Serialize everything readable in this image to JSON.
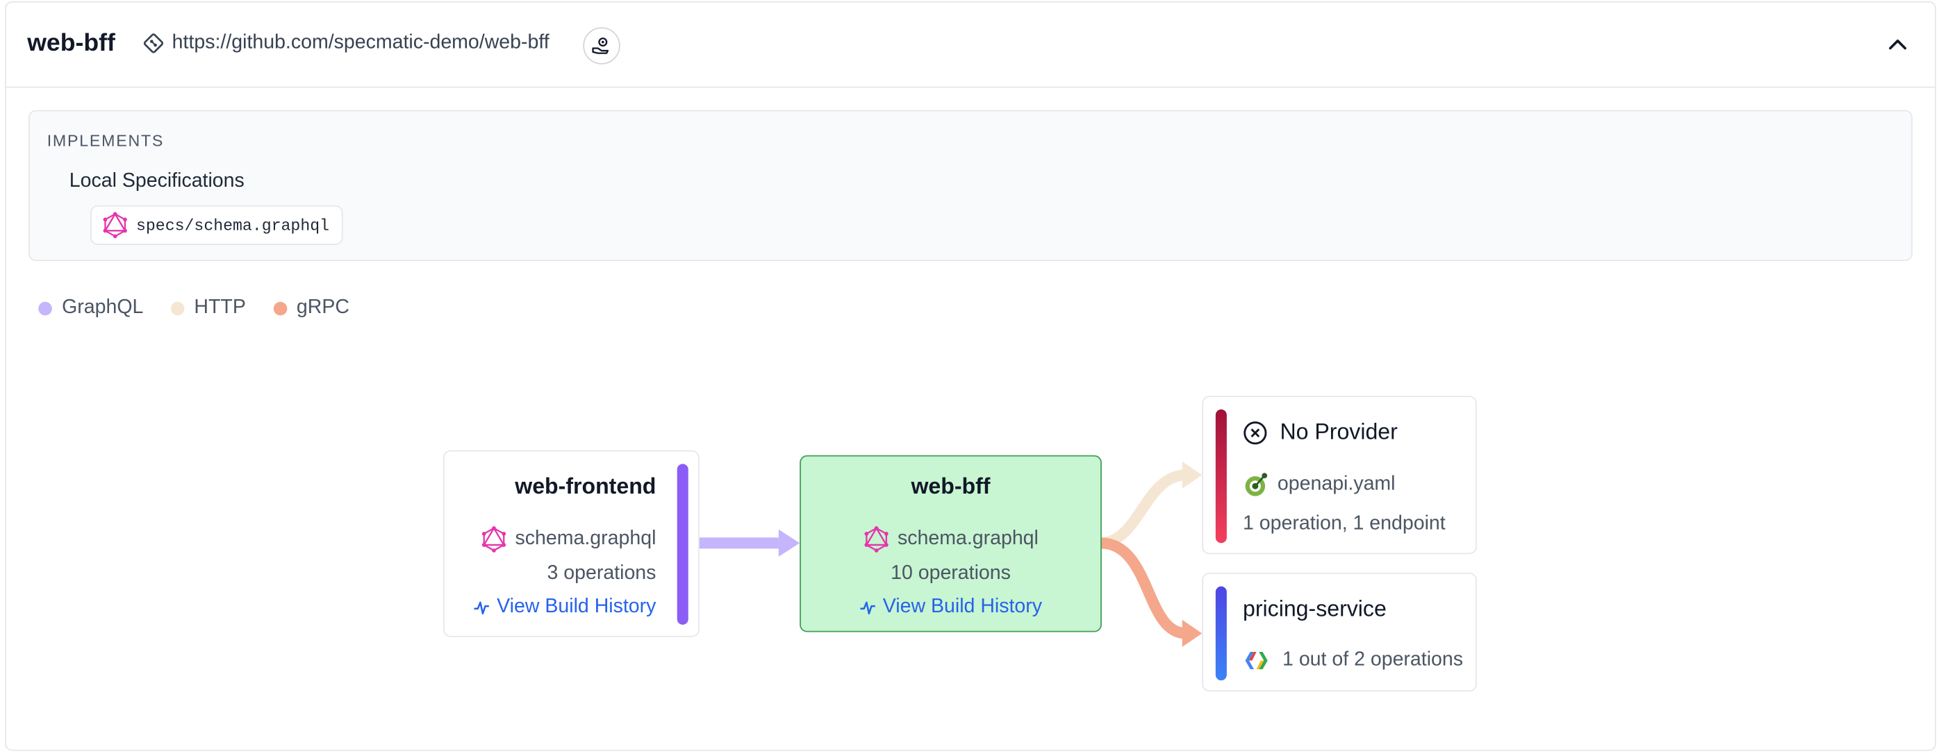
{
  "header": {
    "title": "web-bff",
    "repo_url": "https://github.com/specmatic-demo/web-bff"
  },
  "implements": {
    "heading": "IMPLEMENTS",
    "section_title": "Local Specifications",
    "specs": [
      "specs/schema.graphql"
    ]
  },
  "legend": [
    {
      "label": "GraphQL",
      "color": "#c4b5fd"
    },
    {
      "label": "HTTP",
      "color": "#f5e6d3"
    },
    {
      "label": "gRPC",
      "color": "#f4a78a"
    }
  ],
  "nodes": {
    "frontend": {
      "name": "web-frontend",
      "spec": "schema.graphql",
      "ops": "3 operations",
      "link": "View Build History"
    },
    "bff": {
      "name": "web-bff",
      "spec": "schema.graphql",
      "ops": "10 operations",
      "link": "View Build History"
    },
    "no_provider": {
      "name": "No Provider",
      "spec": "openapi.yaml",
      "ops": "1 operation, 1 endpoint"
    },
    "pricing": {
      "name": "pricing-service",
      "ops": "1 out of 2 operations"
    }
  },
  "icons": {
    "repo": "git-icon",
    "deploy": "hand-gear-icon",
    "collapse": "chevron-up-icon",
    "graphql": "graphql-icon",
    "openapi": "openapi-icon",
    "grpc": "grpc-icon",
    "no_provider": "close-circle-icon",
    "build": "activity-icon"
  },
  "colors": {
    "bff_bg": "#c8f5d2",
    "bff_border": "#3f9d57",
    "frontend_bar": "#8b5cf6",
    "no_provider_bar": "#e11d48",
    "pricing_bar": "#3b82f6"
  }
}
